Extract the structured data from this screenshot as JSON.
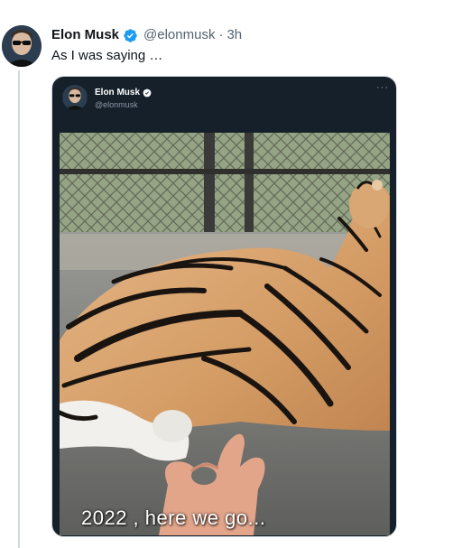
{
  "tweet": {
    "author_name": "Elon Musk",
    "author_handle": "@elonmusk",
    "separator": "·",
    "time": "3h",
    "text": "As I was saying …",
    "avatar_icon": "profile-avatar",
    "verified_icon": "verified-badge-icon",
    "verified_color": "#1d9bf0"
  },
  "media": {
    "inner_author_name": "Elon Musk",
    "inner_author_handle": "@elonmusk",
    "more_icon": "···",
    "image_caption": "2022 , here we go...",
    "background_color": "#15202b"
  }
}
